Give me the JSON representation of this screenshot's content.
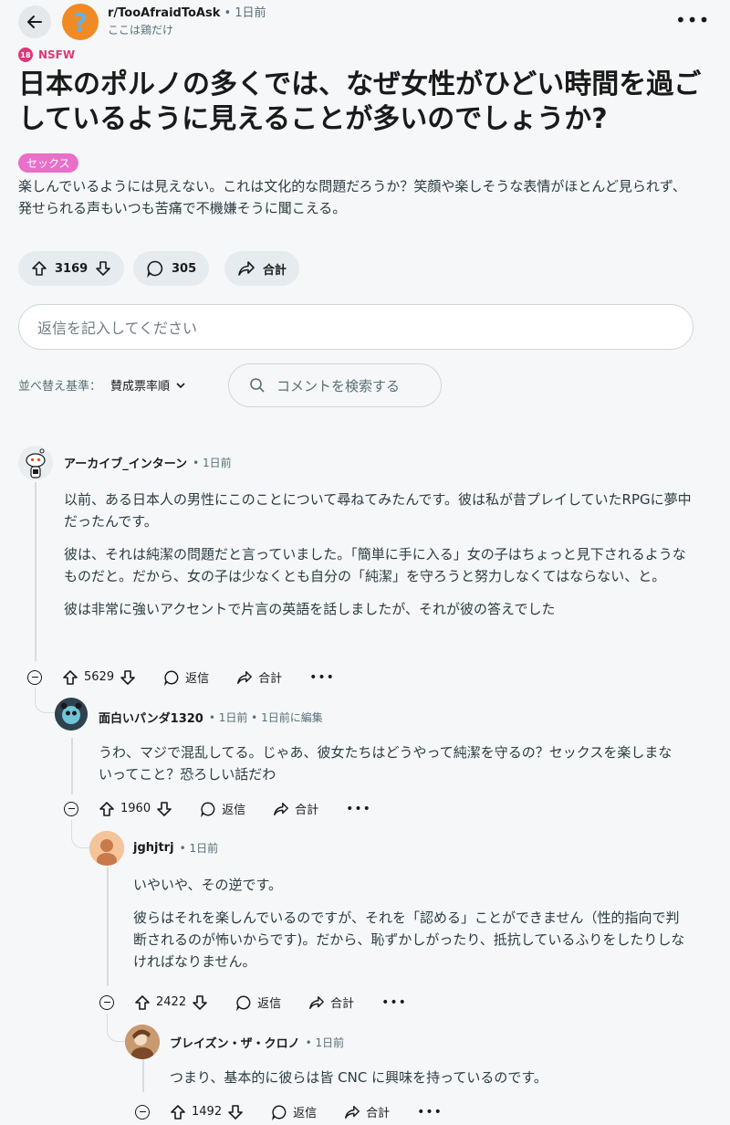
{
  "header": {
    "subreddit": "r/TooAfraidToAsk",
    "time": "• 1日前",
    "username": "ここは鶏だけ"
  },
  "post": {
    "nsfw_label": "NSFW",
    "nsfw_icon_text": "18",
    "title": "日本のポルノの多くでは、なぜ女性がひどい時間を過ごしているように見えることが多いのでしょうか?",
    "flair": "セックス",
    "body": "楽しんでいるようには見えない。これは文化的な問題だろうか？笑顔や楽しそうな表情がほとんど見られず、発せられる声もいつも苦痛で不機嫌そうに聞こえる。",
    "votes": "3169",
    "comments": "305",
    "share_label": "合計"
  },
  "reply_box": {
    "placeholder": "返信を記入してください"
  },
  "sort": {
    "label": "並べ替え基準：",
    "value": "賛成票率順"
  },
  "search": {
    "label": "コメントを検索する"
  },
  "comments": [
    {
      "author": "アーカイブ_インターン",
      "time": "• 1日前",
      "paragraphs": [
        "以前、ある日本人の男性にこのことについて尋ねてみたんです。彼は私が昔プレイしていたRPGに夢中だったんです。",
        "彼は、それは純潔の問題だと言っていました。「簡単に手に入る」女の子はちょっと見下されるようなものだと。だから、女の子は少なくとも自分の「純潔」を守ろうと努力しなくてはならない、と。",
        "彼は非常に強いアクセントで片言の英語を話しましたが、それが彼の答えでした"
      ],
      "votes": "5629",
      "reply_label": "返信",
      "share_label": "合計"
    },
    {
      "author": "面白いパンダ1320",
      "time": "• 1日前 • 1日前に編集",
      "paragraphs": [
        "うわ、マジで混乱してる。じゃあ、彼女たちはどうやって純潔を守るの？セックスを楽しまないってこと？恐ろしい話だわ"
      ],
      "votes": "1960",
      "reply_label": "返信",
      "share_label": "合計"
    },
    {
      "author": "jghjtrj",
      "time": "• 1日前",
      "paragraphs": [
        "いやいや、その逆です。",
        "彼らはそれを楽しんでいるのですが、それを「認める」ことができません（性的指向で判断されるのが怖いからです)。だから、恥ずかしがったり、抵抗しているふりをしたりしなければなりません。"
      ],
      "votes": "2422",
      "reply_label": "返信",
      "share_label": "合計"
    },
    {
      "author": "ブレイズン・ザ・クロノ",
      "time": "• 1日前",
      "paragraphs": [
        "つまり、基本的に彼らは皆 CNC に興味を持っているのです。"
      ],
      "votes": "1492",
      "reply_label": "返信",
      "share_label": "合計"
    }
  ],
  "colors": {
    "background": "#f6f7f8",
    "nsfw": "#d93a79",
    "flair": "#e96fc8",
    "pill": "#e5ebee"
  }
}
